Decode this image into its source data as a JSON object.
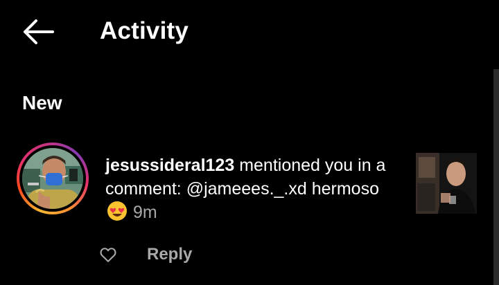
{
  "header": {
    "back_icon": "arrow-left-icon",
    "title": "Activity"
  },
  "section": {
    "title": "New"
  },
  "notification": {
    "username": "jesussideral123",
    "message": " mentioned you in a comment: @jameees._.xd hermoso",
    "emoji": "heart-eyes-emoji",
    "time": "9m",
    "reply_label": "Reply",
    "like_icon": "heart-outline-icon"
  },
  "colors": {
    "background": "#000000",
    "text": "#ffffff",
    "secondary_text": "#a8a8a8",
    "story_ring": [
      "#f7b733",
      "#fc4a1a",
      "#e1306c",
      "#833ab4"
    ]
  }
}
